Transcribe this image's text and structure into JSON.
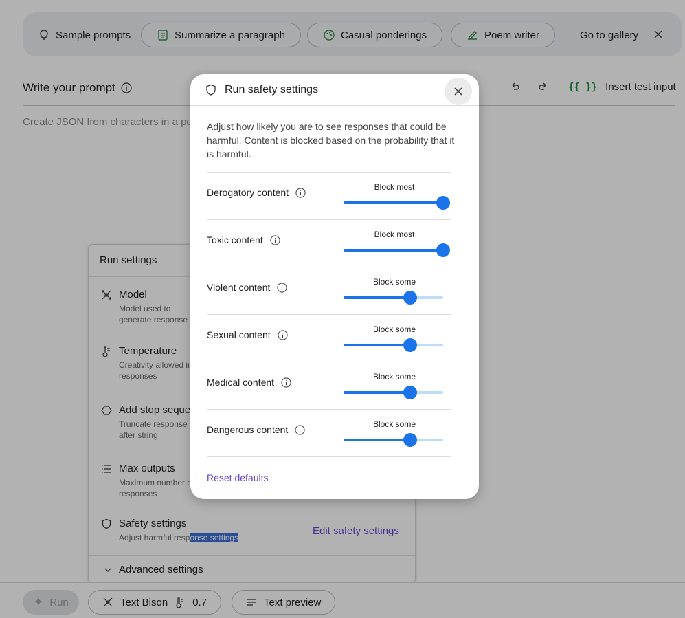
{
  "topbar": {
    "chips": [
      {
        "label": "Sample prompts",
        "icon": "lightbulb-icon"
      },
      {
        "label": "Summarize a paragraph",
        "icon": "document-icon"
      },
      {
        "label": "Casual ponderings",
        "icon": "palette-icon"
      },
      {
        "label": "Poem writer",
        "icon": "pen-icon"
      }
    ],
    "gallery_label": "Go to gallery"
  },
  "prompt": {
    "title": "Write your prompt",
    "placeholder": "Create JSON from characters in a po",
    "insert_test_input": "Insert test input",
    "insert_braces": "{{ }}"
  },
  "run_settings": {
    "title": "Run settings",
    "items": [
      {
        "label": "Model",
        "desc": "Model used to generate response",
        "icon": "model-icon"
      },
      {
        "label": "Temperature",
        "desc": "Creativity allowed in responses",
        "icon": "thermometer-icon"
      },
      {
        "label": "Add stop sequence",
        "desc": "Truncate response after string",
        "icon": "hexagon-icon"
      },
      {
        "label": "Max outputs",
        "desc": "Maximum number of responses",
        "icon": "list-icon"
      }
    ],
    "safety": {
      "label": "Safety settings",
      "desc_start": "Adjust harmful resp",
      "desc_highlight": "onse settings",
      "icon": "shield-icon"
    },
    "edit_safety": "Edit safety settings",
    "advanced": "Advanced settings"
  },
  "bottom": {
    "run": "Run",
    "model": "Text Bison",
    "temperature": "0.7",
    "preview": "Text preview"
  },
  "modal": {
    "title": "Run safety settings",
    "description": "Adjust how likely you are to see responses that could be harmful. Content is blocked based on the probability that it is harmful.",
    "settings": [
      {
        "label": "Derogatory content",
        "level": "Block most",
        "value_fraction": 1.0
      },
      {
        "label": "Toxic content",
        "level": "Block most",
        "value_fraction": 1.0
      },
      {
        "label": "Violent content",
        "level": "Block some",
        "value_fraction": 0.667
      },
      {
        "label": "Sexual content",
        "level": "Block some",
        "value_fraction": 0.667
      },
      {
        "label": "Medical content",
        "level": "Block some",
        "value_fraction": 0.667
      },
      {
        "label": "Dangerous content",
        "level": "Block some",
        "value_fraction": 0.667
      }
    ],
    "reset": "Reset defaults"
  },
  "colors": {
    "accent": "#1a73e8",
    "track": "#bcdcf7",
    "link": "#6a3fd0"
  }
}
